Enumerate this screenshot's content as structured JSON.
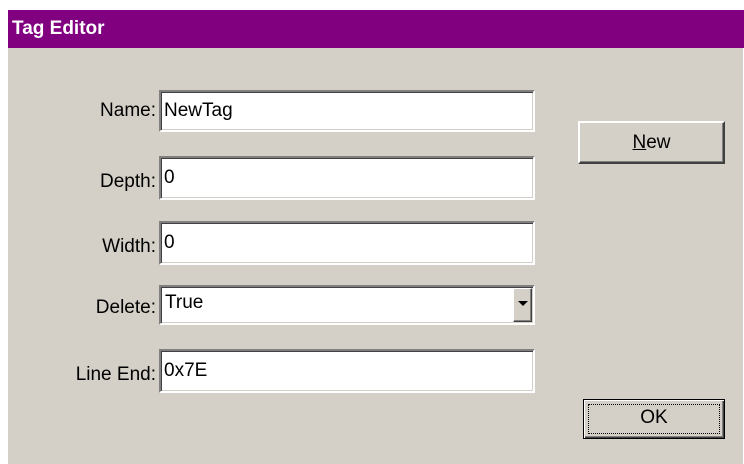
{
  "window": {
    "title": "Tag Editor",
    "title_bar_color": "#800080"
  },
  "form": {
    "name": {
      "label": "Name:",
      "value": "NewTag"
    },
    "depth": {
      "label": "Depth:",
      "value": "0"
    },
    "width": {
      "label": "Width:",
      "value": "0"
    },
    "delete": {
      "label": "Delete:",
      "value": "True",
      "dropdown_icon": "chevron-down-icon"
    },
    "line_end": {
      "label": "Line End:",
      "value": "0x7E"
    }
  },
  "buttons": {
    "new": {
      "mnemonic": "N",
      "rest": "ew"
    },
    "ok": {
      "label": "OK"
    }
  }
}
